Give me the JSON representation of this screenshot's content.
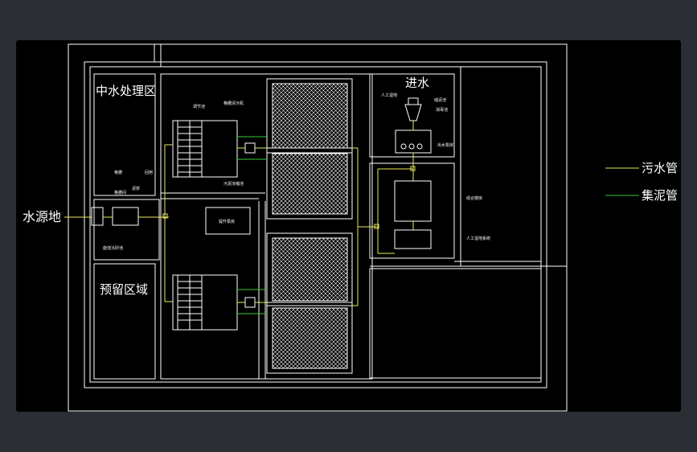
{
  "labels": {
    "zhongshui": "中水处理区",
    "jinshui": "进水",
    "yuliu": "预留区域",
    "shuiyuan": "水源地"
  },
  "legend": {
    "sewage_pipe": "污水管",
    "sludge_pipe": "集泥管",
    "sewage_color": "#e8e85a",
    "sludge_color": "#38c838"
  },
  "annotations": {
    "a1": "调节池",
    "a2": "格栅清污机",
    "a3": "格栅",
    "a4": "格栅间",
    "a5": "提升泵房",
    "a6": "旋流沉砂池",
    "a7": "污泥浓缩池",
    "a8": "人工湿地",
    "a9": "储泥池",
    "a10": "消毒池",
    "a11": "出水泵房",
    "a12": "综合楼房",
    "a13": "人工湿地系统",
    "a14": "泥饼",
    "a15": "回用"
  }
}
